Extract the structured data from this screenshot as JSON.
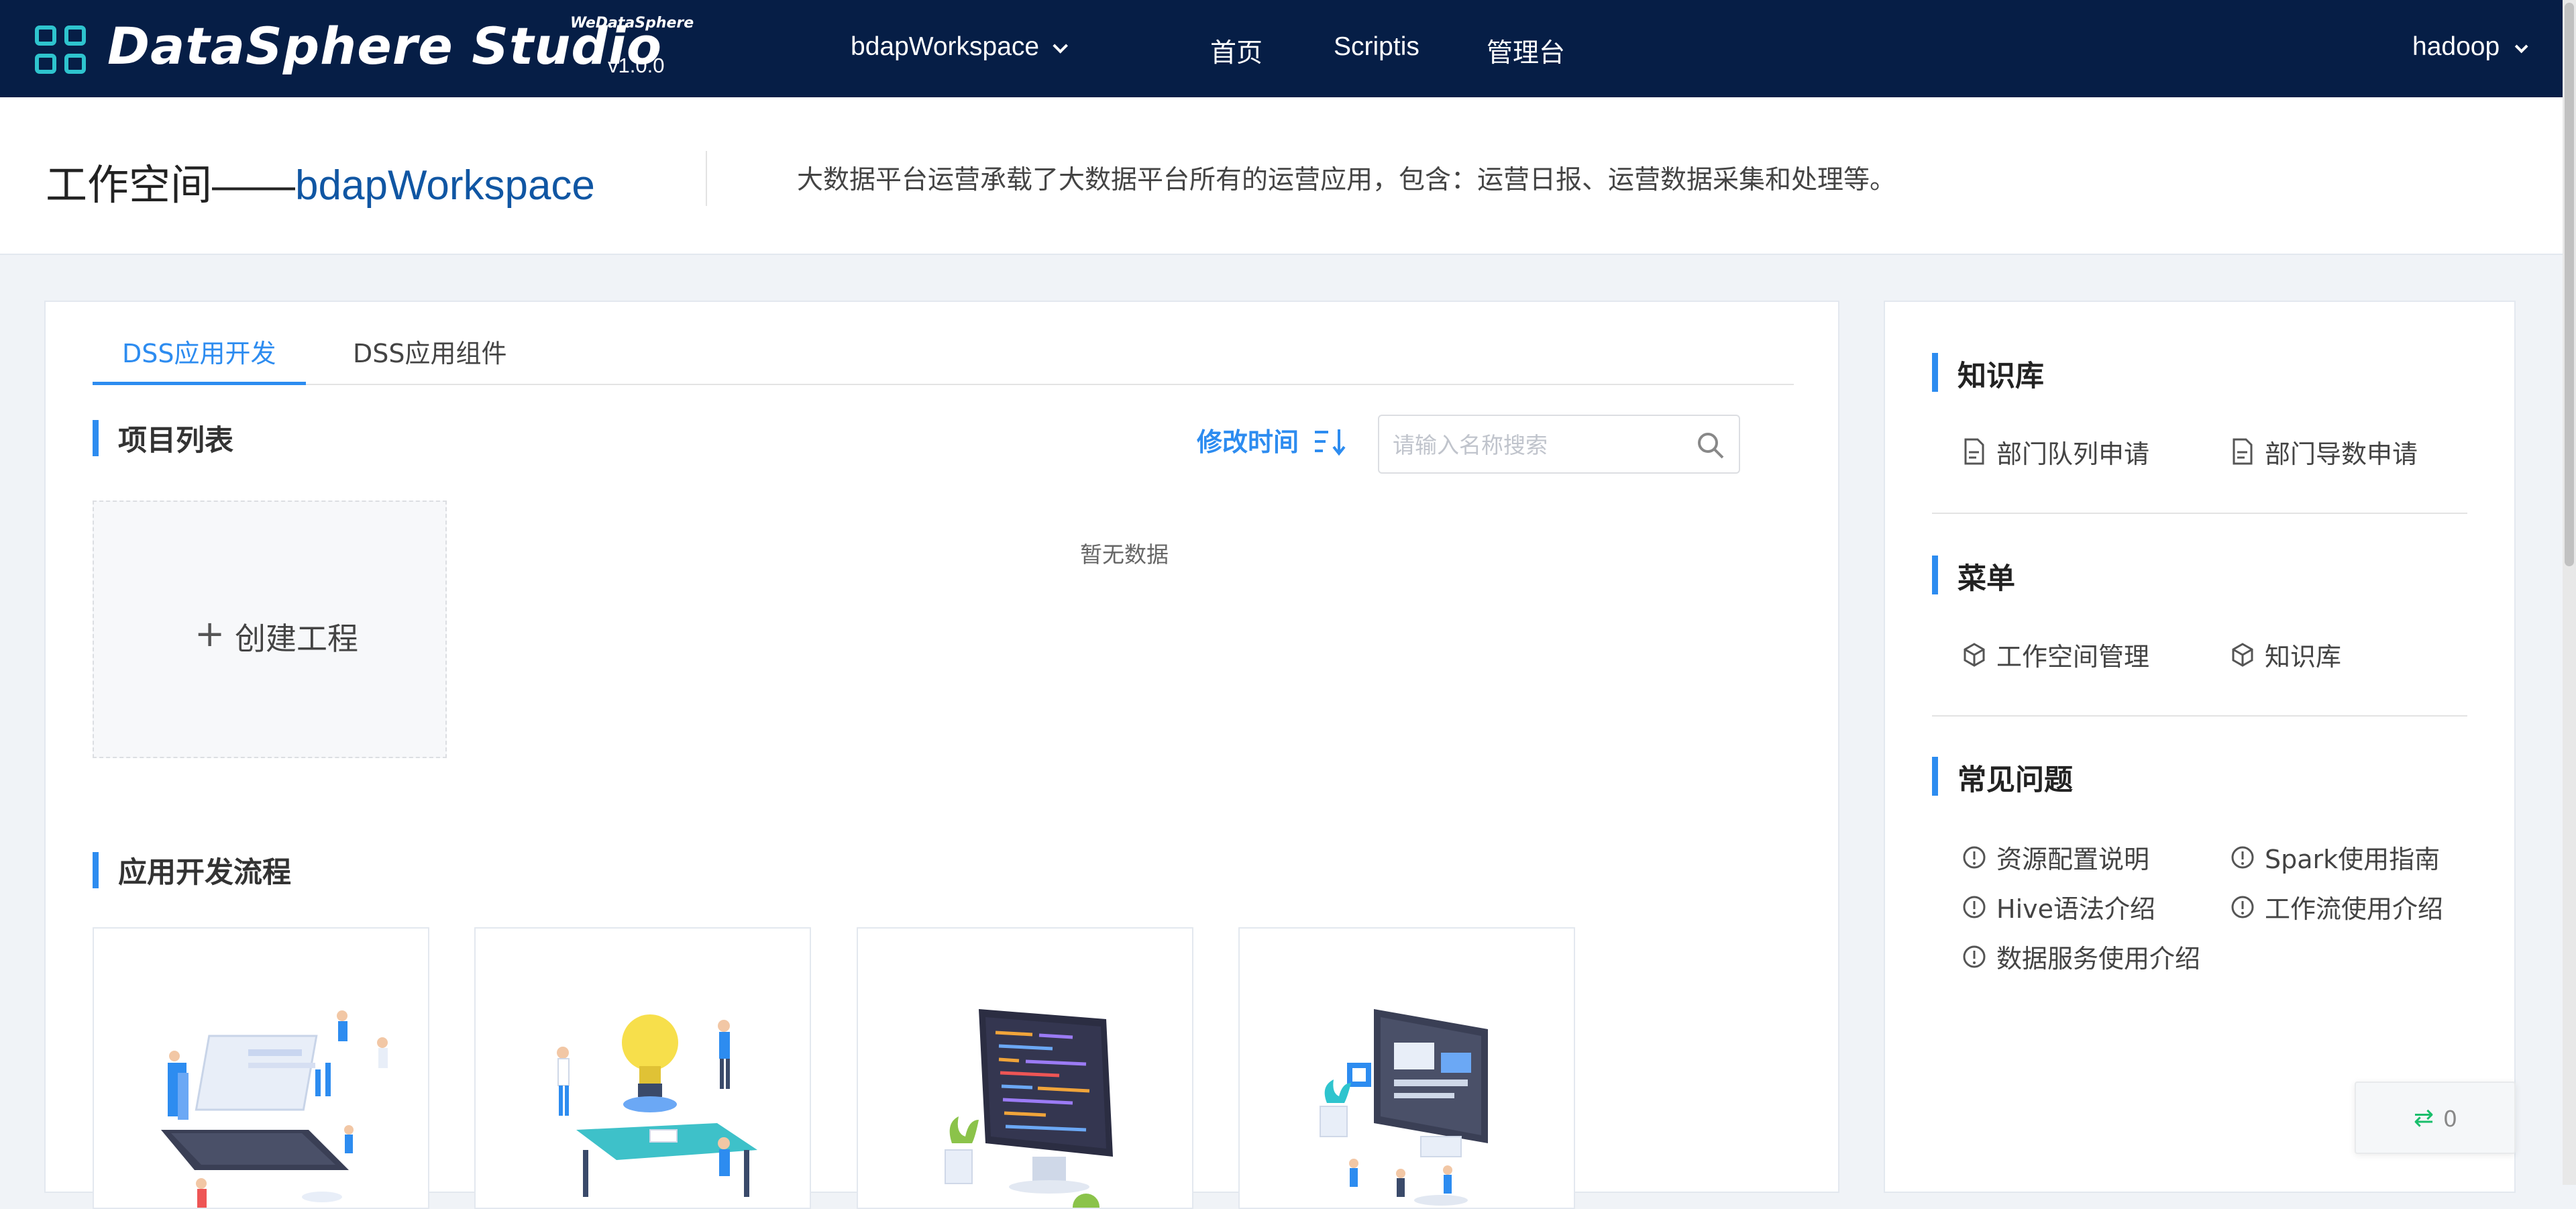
{
  "topbar": {
    "brand": "DataSphere Studio",
    "brand_sub": "WeDataSphere",
    "version": "v1.0.0",
    "workspace": "bdapWorkspace",
    "nav": [
      "首页",
      "Scriptis",
      "管理台"
    ],
    "user": "hadoop",
    "bg_color": "#061e46",
    "logo_color": "#2ec4ce"
  },
  "header": {
    "title_prefix": "工作空间——",
    "title_workspace": "bdapWorkspace",
    "description": "大数据平台运营承载了大数据平台所有的运营应用，包含：运营日报、运营数据采集和处理等。"
  },
  "main": {
    "tabs": [
      "DSS应用开发",
      "DSS应用组件"
    ],
    "project_list_title": "项目列表",
    "sort_label": "修改时间",
    "search_placeholder": "请输入名称搜索",
    "create_label": "创建工程",
    "no_data": "暂无数据",
    "flow_title": "应用开发流程",
    "accent": "#2d8cf0"
  },
  "side": {
    "knowledge_title": "知识库",
    "knowledge_links": [
      "部门队列申请",
      "部门导数申请"
    ],
    "menu_title": "菜单",
    "menu_links": [
      "工作空间管理",
      "知识库"
    ],
    "faq_title": "常见问题",
    "faq_links": [
      "资源配置说明",
      "Spark使用指南",
      "Hive语法介绍",
      "工作流使用介绍",
      "数据服务使用介绍"
    ]
  },
  "float_badge": {
    "count": "0"
  }
}
